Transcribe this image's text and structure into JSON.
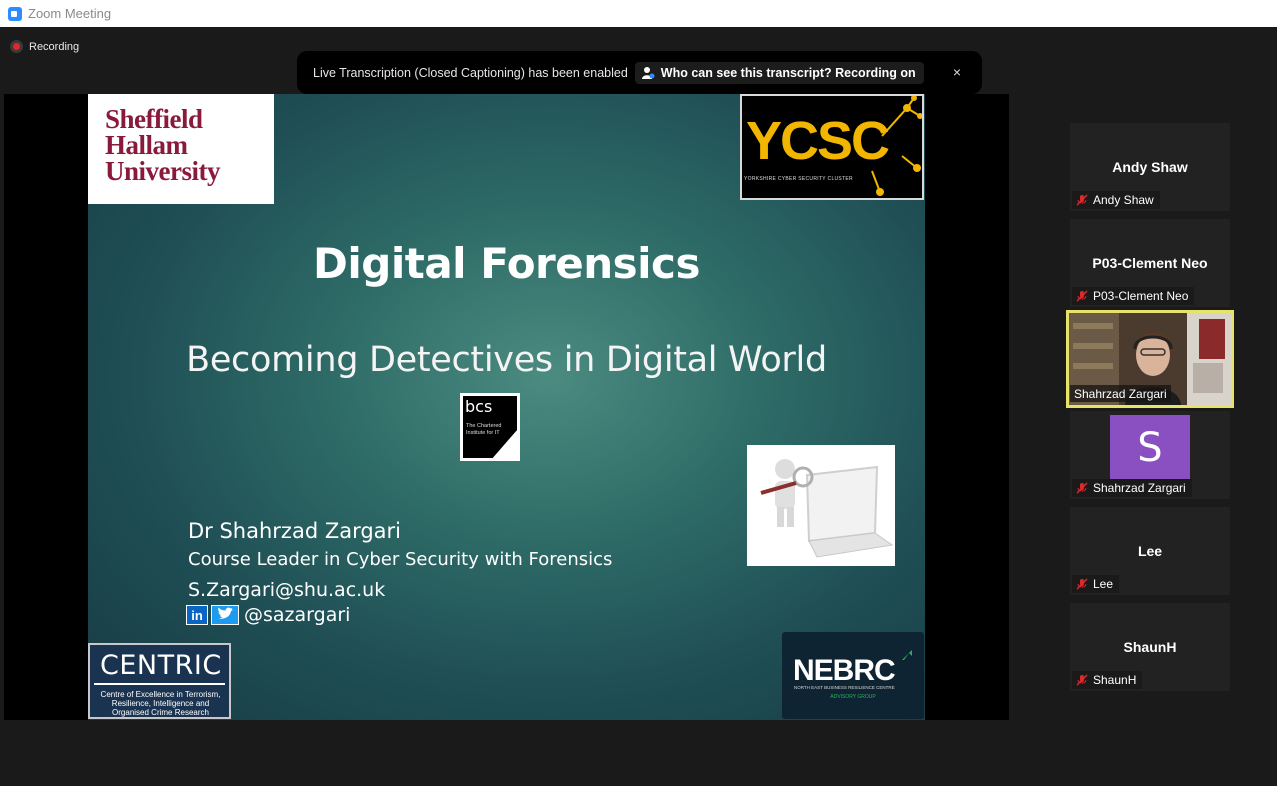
{
  "window": {
    "title": "Zoom Meeting"
  },
  "recording": {
    "label": "Recording"
  },
  "banner": {
    "message": "Live Transcription (Closed Captioning) has been enabled",
    "link": "Who can see this transcript? Recording on",
    "close": "×"
  },
  "slide": {
    "logo_university": [
      "Sheffield",
      "Hallam",
      "University"
    ],
    "logo_ycsc": {
      "text": "YCSC",
      "tagline": "YORKSHIRE CYBER SECURITY CLUSTER"
    },
    "title": "Digital Forensics",
    "subtitle": "Becoming Detectives in Digital World",
    "bcs": {
      "text": "bcs",
      "tagline": "The Chartered Institute for IT"
    },
    "author_name": "Dr Shahrzad Zargari",
    "author_role": "Course Leader in Cyber Security with Forensics",
    "author_email": "S.Zargari@shu.ac.uk",
    "linkedin_glyph": "in",
    "twitter_handle": "@sazargari",
    "centric": {
      "name": "CENTRIC",
      "desc": "Centre of Excellence in Terrorism, Resilience, Intelligence and Organised Crime Research"
    },
    "nebrc": {
      "name": "NEBRC",
      "desc": "NORTH EAST BUSINESS RESILIENCE CENTRE",
      "group": "ADVISORY GROUP"
    }
  },
  "participants": [
    {
      "name": "Andy Shaw",
      "label": "Andy Shaw",
      "muted": true
    },
    {
      "name": "P03-Clement Neo",
      "label": "P03-Clement Neo",
      "muted": true
    },
    {
      "label": "Shahrzad Zargari",
      "video": true,
      "active_speaker": true
    },
    {
      "avatar_letter": "S",
      "label": "Shahrzad Zargari",
      "muted": true
    },
    {
      "name": "Lee",
      "label": "Lee",
      "muted": true
    },
    {
      "name": "ShaunH",
      "label": "ShaunH",
      "muted": true
    }
  ],
  "colors": {
    "speaker_border": "#e6e26a",
    "avatar_bg": "#8a4fc0",
    "muted_icon": "#e02828"
  },
  "icons": {
    "app": "zoom-icon",
    "record": "record-dot-icon",
    "person": "person-icon",
    "close": "close-icon",
    "muted": "mic-muted-icon"
  }
}
